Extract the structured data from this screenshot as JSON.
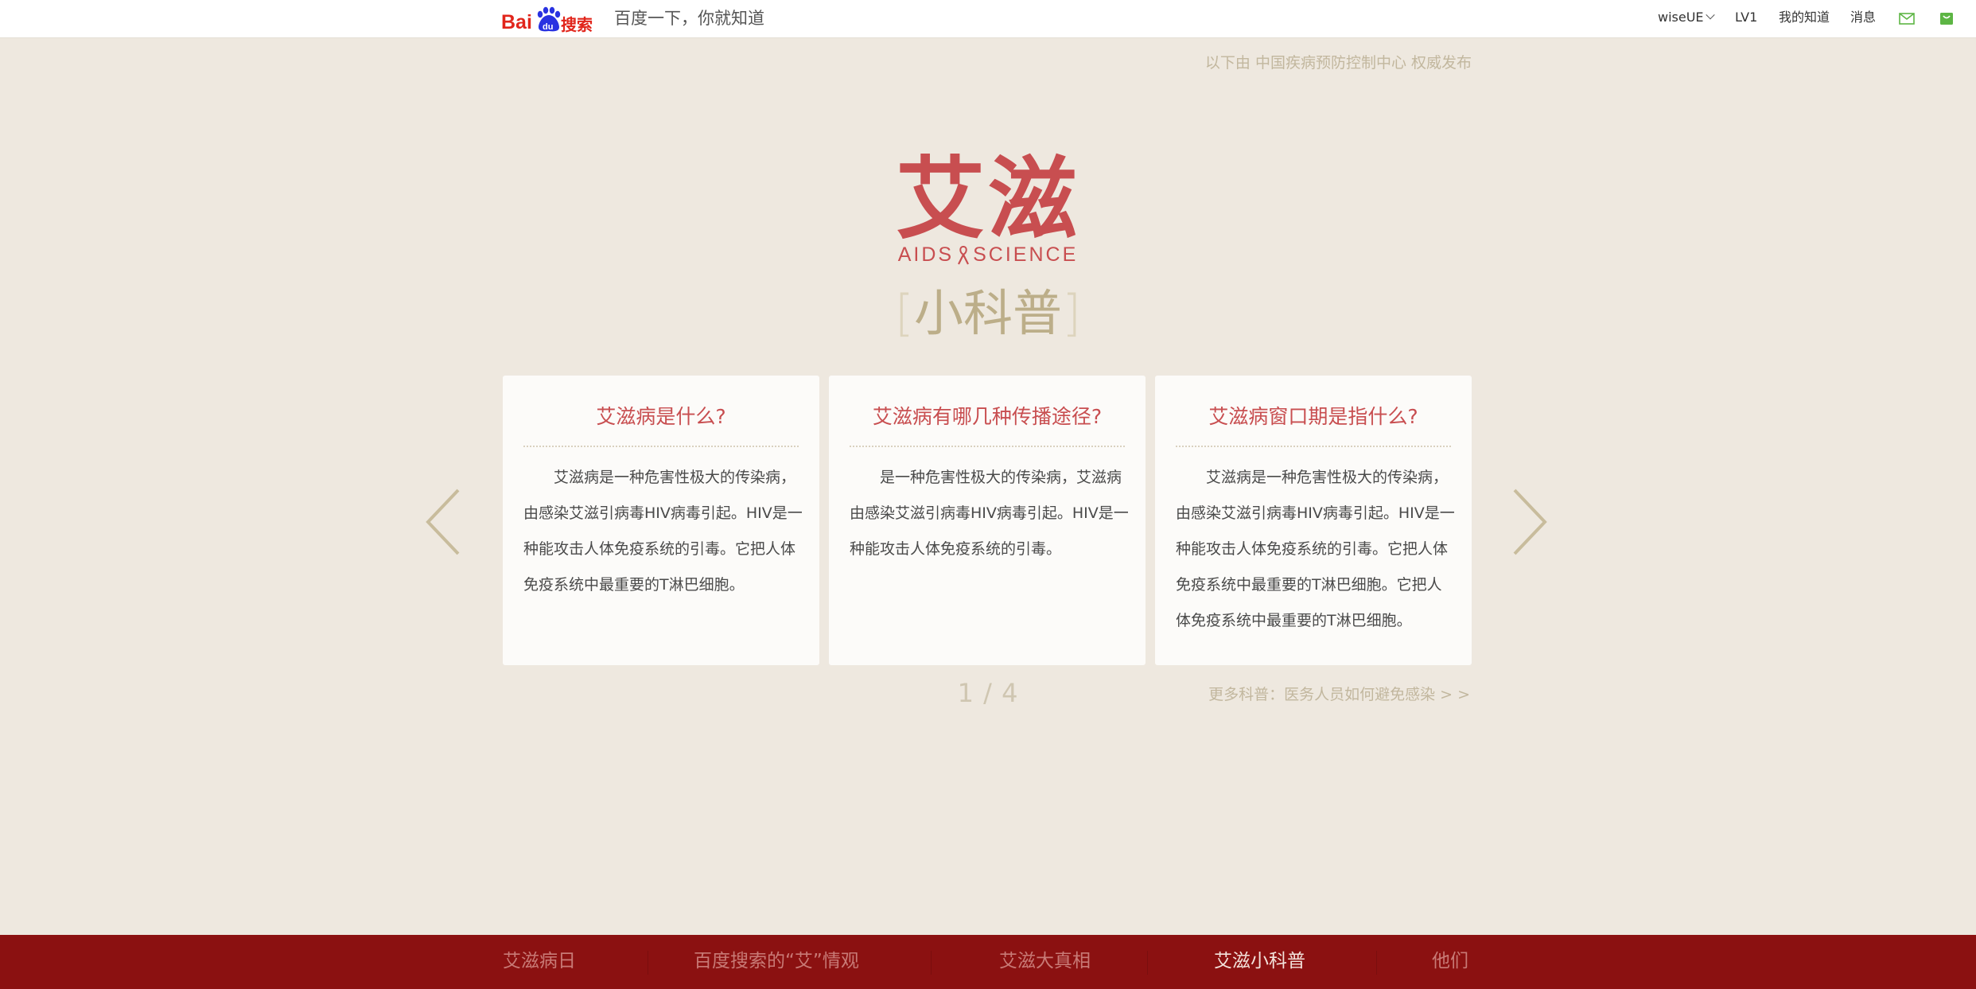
{
  "header": {
    "logo_text": "Bai du 搜索",
    "slogan": "百度一下，你就知道",
    "nav": {
      "username": "wiseUE",
      "level": "LV1",
      "my_zhidao": "我的知道",
      "messages": "消息"
    }
  },
  "source_note": "以下由 中国疾病预防控制中心 权威发布",
  "hero": {
    "title_cn": "艾滋",
    "title_en_left": "AIDS",
    "title_en_right": "SCIENCE",
    "subtitle": "小科普",
    "bracket_left": "[",
    "bracket_right": "]"
  },
  "cards": [
    {
      "title": "艾滋病是什么?",
      "body": "艾滋病是一种危害性极大的传染病，由感染艾滋引病毒HIV病毒引起。HIV是一种能攻击人体免疫系统的引毒。它把人体免疫系统中最重要的T淋巴细胞。"
    },
    {
      "title": "艾滋病有哪几种传播途径?",
      "body": "是一种危害性极大的传染病，艾滋病由感染艾滋引病毒HIV病毒引起。HIV是一种能攻击人体免疫系统的引毒。"
    },
    {
      "title": "艾滋病窗口期是指什么?",
      "body": "艾滋病是一种危害性极大的传染病，由感染艾滋引病毒HIV病毒引起。HIV是一种能攻击人体免疫系统的引毒。它把人体免疫系统中最重要的T淋巴细胞。它把人体免疫系统中最重要的T淋巴细胞。"
    }
  ],
  "pager": "1 / 4",
  "more_link": "更多科普：医务人员如何避免感染 > >",
  "bottom_nav": [
    {
      "label": "艾滋病日",
      "active": false
    },
    {
      "label": "百度搜索的“艾”情观",
      "active": false
    },
    {
      "label": "艾滋大真相",
      "active": false
    },
    {
      "label": "艾滋小科普",
      "active": true
    },
    {
      "label": "他们",
      "active": false
    }
  ],
  "colors": {
    "background": "#eee8df",
    "accent_red": "#c84e50",
    "bottom_bar": "#8b1111",
    "muted_gold": "#bcae89"
  },
  "icons": [
    "baidu-paw-icon",
    "chevron-down-icon",
    "mail-icon",
    "shopping-bag-icon",
    "red-ribbon-icon",
    "arrow-left-icon",
    "arrow-right-icon"
  ]
}
